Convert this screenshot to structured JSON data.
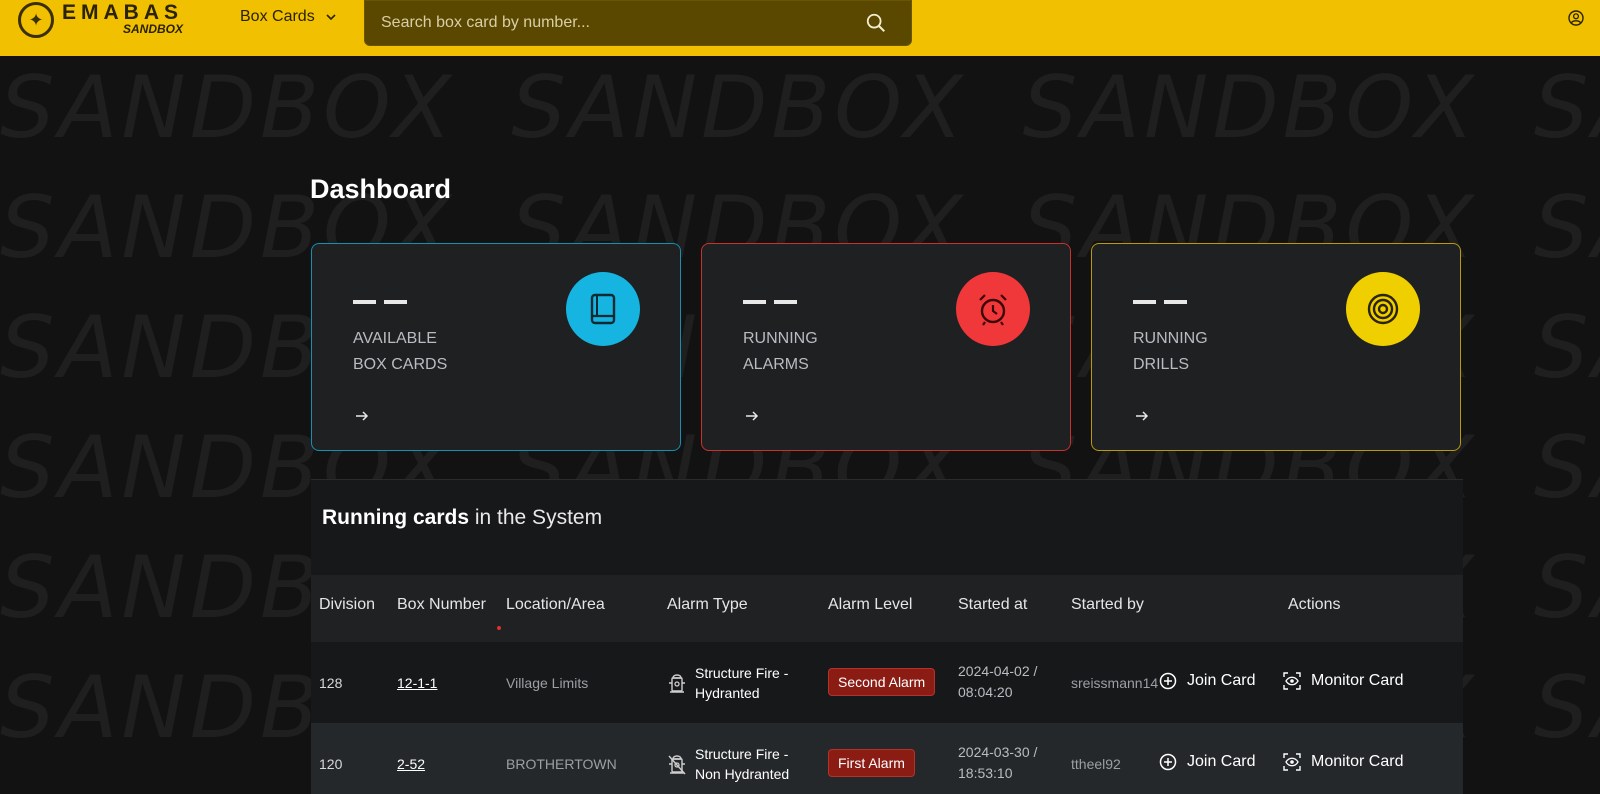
{
  "header": {
    "logo_main": "EMABAS",
    "logo_sub": "SANDBOX",
    "nav_label": "Box Cards",
    "search_placeholder": "Search box card by number...",
    "accent": "#f1c000"
  },
  "watermark_text": "SANDBOX",
  "page_title": "Dashboard",
  "cards": [
    {
      "count": "— —",
      "label_line1": "AVAILABLE",
      "label_line2": "BOX CARDS",
      "icon": "book-icon",
      "color": "#16b4e0"
    },
    {
      "count": "— —",
      "label_line1": "RUNNING",
      "label_line2": "ALARMS",
      "icon": "alarm-clock-icon",
      "color": "#f0383a"
    },
    {
      "count": "— —",
      "label_line1": "RUNNING",
      "label_line2": "DRILLS",
      "icon": "target-icon",
      "color": "#f0cf00"
    }
  ],
  "running": {
    "title_bold": "Running cards",
    "title_rest": " in the System",
    "columns": [
      "Division",
      "Box Number",
      "Location/Area",
      "Alarm Type",
      "Alarm Level",
      "Started at",
      "Started by",
      "Actions"
    ],
    "rows": [
      {
        "division": "128",
        "box_number": "12-1-1",
        "location": "Village Limits",
        "alarm_type_line1": "Structure Fire -",
        "alarm_type_line2": "Hydranted",
        "alarm_level": "Second Alarm",
        "started_date": "2024-04-02 /",
        "started_time": "08:04:20",
        "started_by": "sreissmann14",
        "join_label": "Join Card",
        "monitor_label": "Monitor Card"
      },
      {
        "division": "120",
        "box_number": "2-52",
        "location": "BROTHERTOWN",
        "alarm_type_line1": "Structure Fire -",
        "alarm_type_line2": "Non Hydranted",
        "alarm_level": "First Alarm",
        "started_date": "2024-03-30 /",
        "started_time": "18:53:10",
        "started_by": "ttheel92",
        "join_label": "Join Card",
        "monitor_label": "Monitor Card"
      }
    ]
  }
}
